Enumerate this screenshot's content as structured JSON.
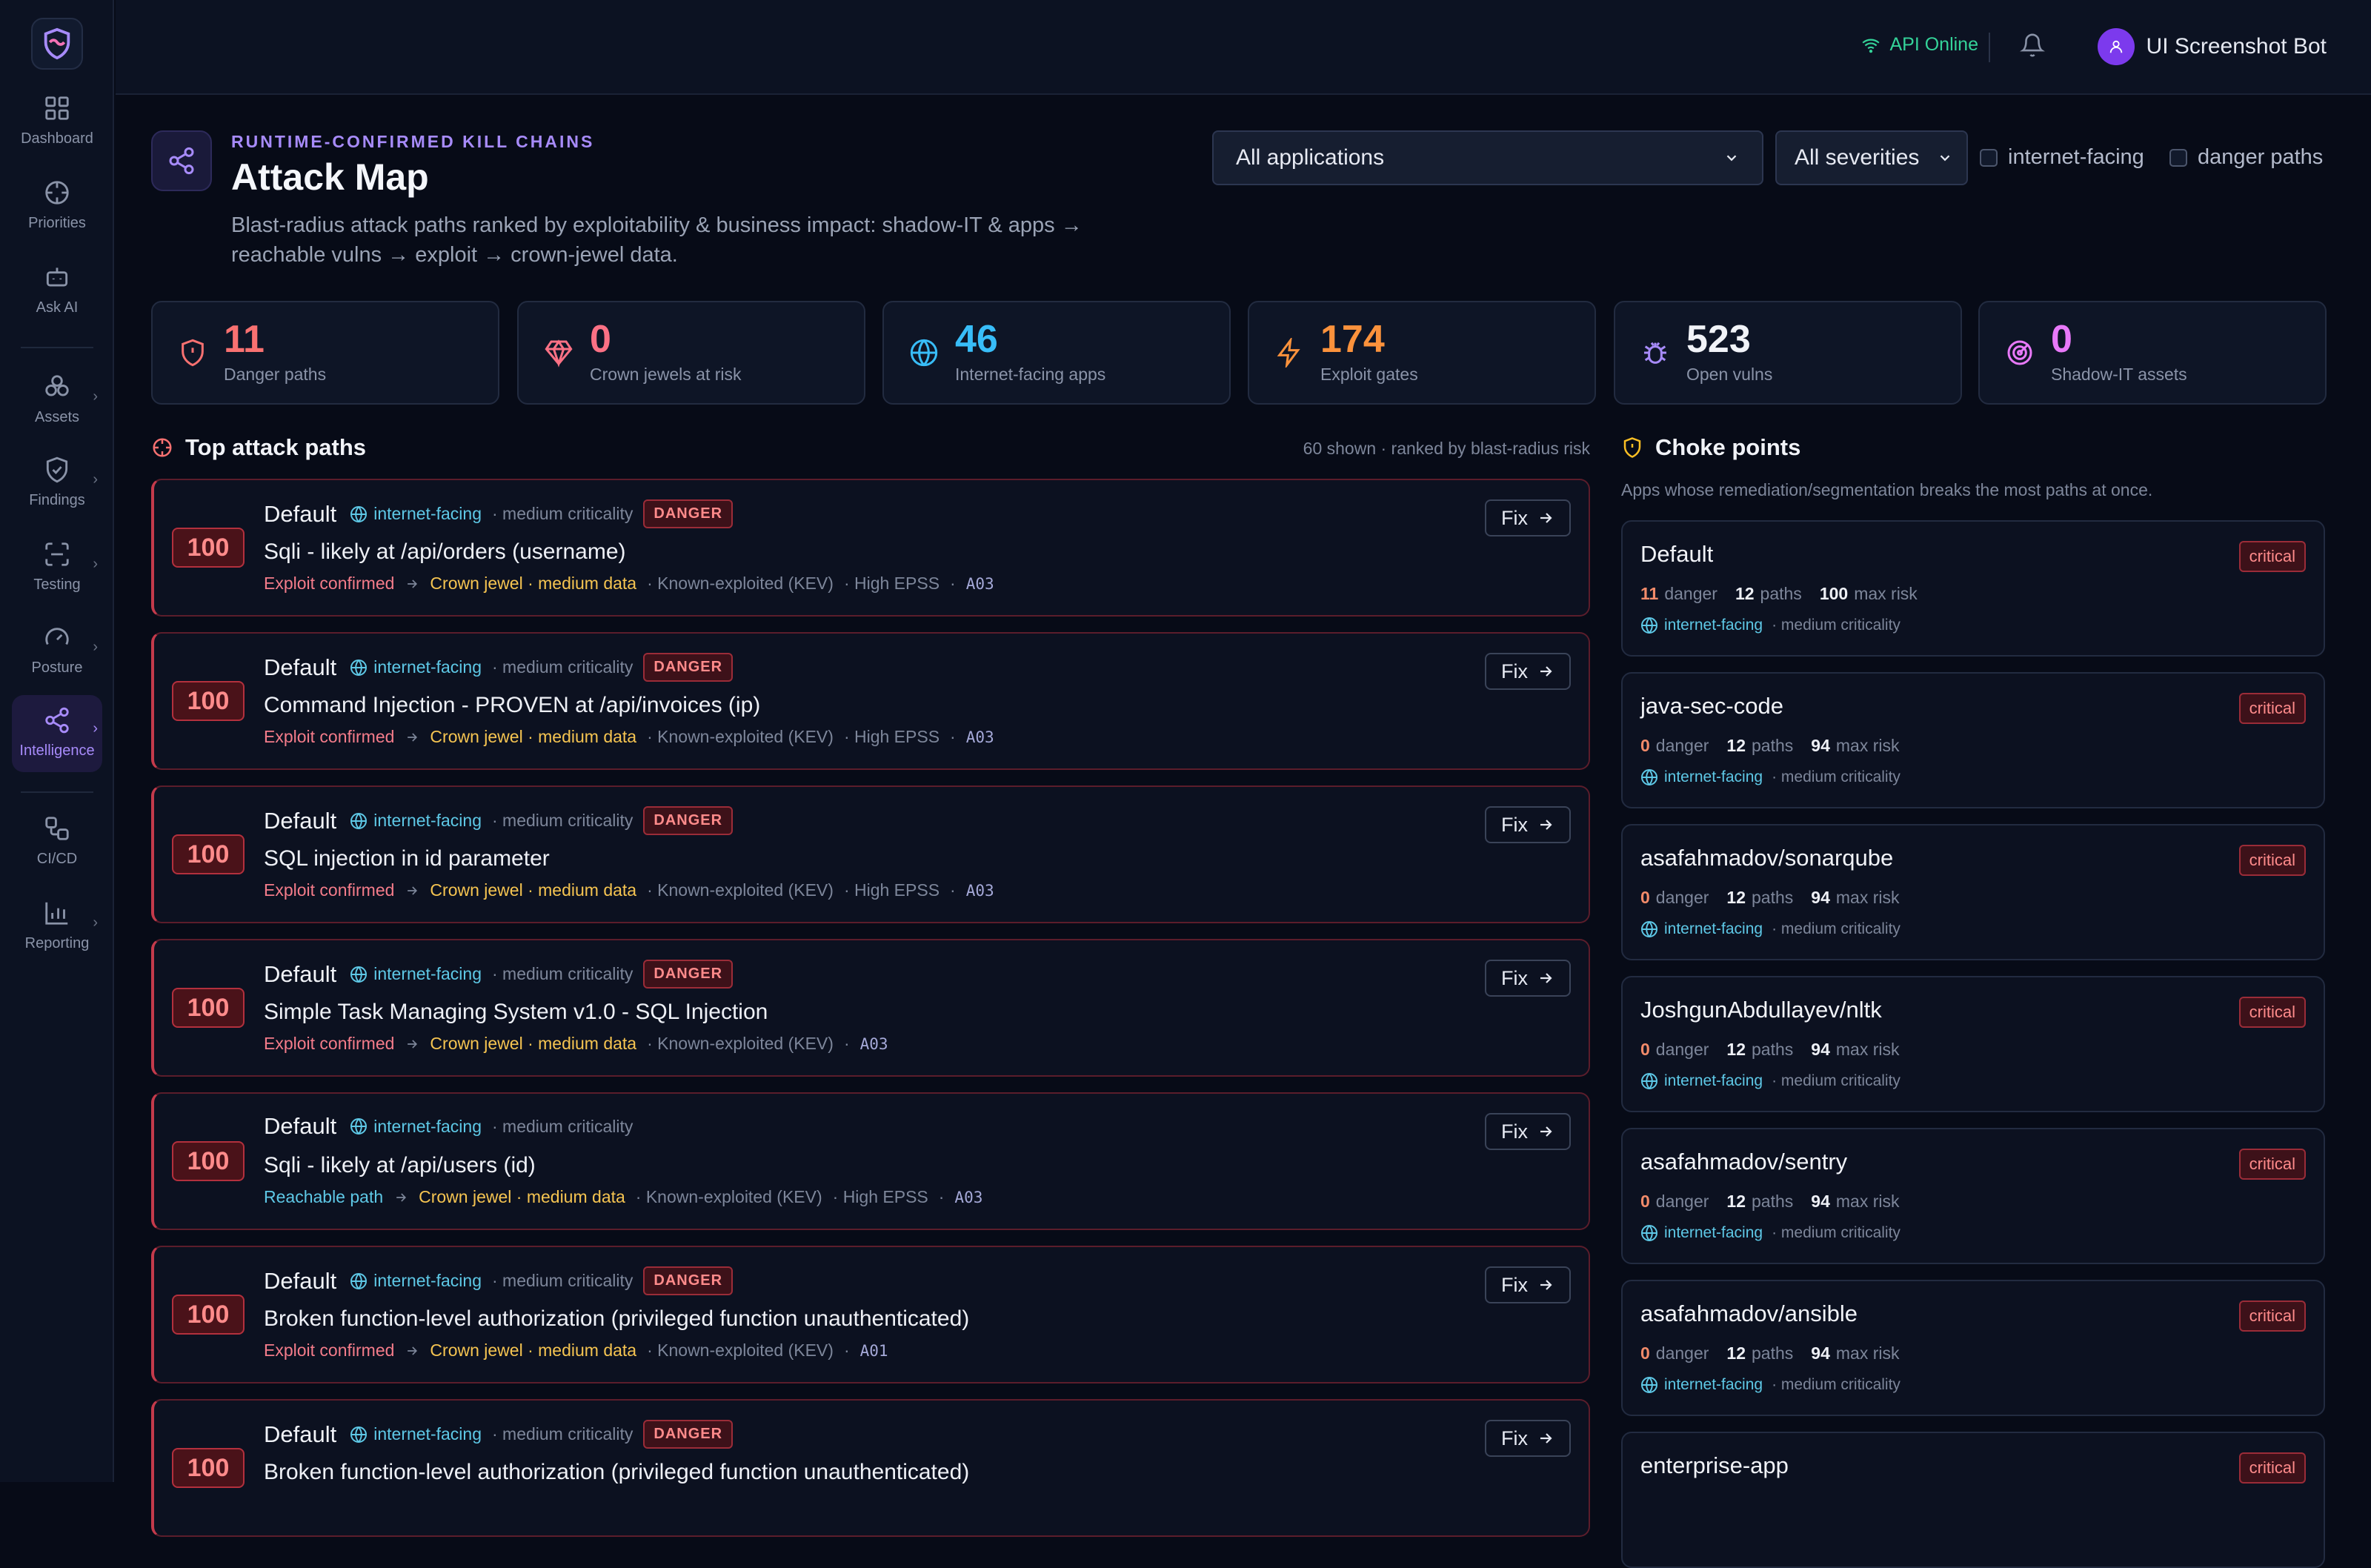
{
  "sidebar": {
    "items": [
      {
        "label": "Dashboard",
        "icon": "grid-icon"
      },
      {
        "label": "Priorities",
        "icon": "crosshair-icon"
      },
      {
        "label": "Ask AI",
        "icon": "bot-icon"
      },
      {
        "label": "Assets",
        "icon": "boxes-icon"
      },
      {
        "label": "Findings",
        "icon": "shield-check-icon"
      },
      {
        "label": "Testing",
        "icon": "scan-icon"
      },
      {
        "label": "Posture",
        "icon": "gauge-icon"
      },
      {
        "label": "Intelligence",
        "icon": "share-icon",
        "active": true
      },
      {
        "label": "CI/CD",
        "icon": "workflow-icon"
      },
      {
        "label": "Reporting",
        "icon": "bar-chart-icon"
      }
    ]
  },
  "header": {
    "api_status": "API Online",
    "user_name": "UI Screenshot Bot"
  },
  "page": {
    "eyebrow": "RUNTIME-CONFIRMED KILL CHAINS",
    "title": "Attack Map",
    "description": "Blast-radius attack paths ranked by exploitability & business impact: shadow-IT & apps → reachable vulns → exploit → crown-jewel data."
  },
  "filters": {
    "application": "All applications",
    "severity": "All severities",
    "internet_facing": "internet-facing",
    "danger_paths": "danger paths"
  },
  "stats": [
    {
      "value": "11",
      "label": "Danger paths",
      "color": "#f87171"
    },
    {
      "value": "0",
      "label": "Crown jewels at risk",
      "color": "#fb7185"
    },
    {
      "value": "46",
      "label": "Internet-facing apps",
      "color": "#38bdf8"
    },
    {
      "value": "174",
      "label": "Exploit gates",
      "color": "#fb923c"
    },
    {
      "value": "523",
      "label": "Open vulns",
      "color": "#f1f3f8"
    },
    {
      "value": "0",
      "label": "Shadow-IT assets",
      "color": "#e879f9"
    }
  ],
  "attack_paths": {
    "title": "Top attack paths",
    "meta": "60 shown · ranked by blast-radius risk",
    "fix_label": "Fix",
    "items": [
      {
        "score": "100",
        "app": "Default",
        "net": "internet-facing",
        "crit": "· medium criticality",
        "badge": "DANGER",
        "title": "Sqli - likely at /api/orders (username)",
        "evidence": "Exploit confirmed",
        "crown": "Crown jewel · medium data",
        "kev": "· Known-exploited (KEV)",
        "epss": "· High EPSS",
        "owasp": "A03"
      },
      {
        "score": "100",
        "app": "Default",
        "net": "internet-facing",
        "crit": "· medium criticality",
        "badge": "DANGER",
        "title": "Command Injection - PROVEN at /api/invoices (ip)",
        "evidence": "Exploit confirmed",
        "crown": "Crown jewel · medium data",
        "kev": "· Known-exploited (KEV)",
        "epss": "· High EPSS",
        "owasp": "A03"
      },
      {
        "score": "100",
        "app": "Default",
        "net": "internet-facing",
        "crit": "· medium criticality",
        "badge": "DANGER",
        "title": "SQL injection in id parameter",
        "evidence": "Exploit confirmed",
        "crown": "Crown jewel · medium data",
        "kev": "· Known-exploited (KEV)",
        "epss": "· High EPSS",
        "owasp": "A03"
      },
      {
        "score": "100",
        "app": "Default",
        "net": "internet-facing",
        "crit": "· medium criticality",
        "badge": "DANGER",
        "title": "Simple Task Managing System v1.0 - SQL Injection",
        "evidence": "Exploit confirmed",
        "crown": "Crown jewel · medium data",
        "kev": "· Known-exploited (KEV)",
        "epss": "",
        "owasp": "A03"
      },
      {
        "score": "100",
        "app": "Default",
        "net": "internet-facing",
        "crit": "· medium criticality",
        "badge": "",
        "title": "Sqli - likely at /api/users (id)",
        "evidence": "Reachable path",
        "crown": "Crown jewel · medium data",
        "kev": "· Known-exploited (KEV)",
        "epss": "· High EPSS",
        "owasp": "A03"
      },
      {
        "score": "100",
        "app": "Default",
        "net": "internet-facing",
        "crit": "· medium criticality",
        "badge": "DANGER",
        "title": "Broken function-level authorization (privileged function unauthenticated)",
        "evidence": "Exploit confirmed",
        "crown": "Crown jewel · medium data",
        "kev": "· Known-exploited (KEV)",
        "epss": "",
        "owasp": "A01"
      },
      {
        "score": "100",
        "app": "Default",
        "net": "internet-facing",
        "crit": "· medium criticality",
        "badge": "DANGER",
        "title": "Broken function-level authorization (privileged function unauthenticated)",
        "evidence": "",
        "crown": "",
        "kev": "",
        "epss": "",
        "owasp": ""
      }
    ]
  },
  "choke_points": {
    "title": "Choke points",
    "subtitle": "Apps whose remediation/segmentation breaks the most paths at once.",
    "labels": {
      "danger": "danger",
      "paths": "paths",
      "max_risk": "max risk"
    },
    "items": [
      {
        "name": "Default",
        "badge": "critical",
        "danger": "11",
        "paths": "12",
        "max_risk": "100",
        "net": "internet-facing",
        "crit": "· medium criticality"
      },
      {
        "name": "java-sec-code",
        "badge": "critical",
        "danger": "0",
        "paths": "12",
        "max_risk": "94",
        "net": "internet-facing",
        "crit": "· medium criticality"
      },
      {
        "name": "asafahmadov/sonarqube",
        "badge": "critical",
        "danger": "0",
        "paths": "12",
        "max_risk": "94",
        "net": "internet-facing",
        "crit": "· medium criticality"
      },
      {
        "name": "JoshgunAbdullayev/nltk",
        "badge": "critical",
        "danger": "0",
        "paths": "12",
        "max_risk": "94",
        "net": "internet-facing",
        "crit": "· medium criticality"
      },
      {
        "name": "asafahmadov/sentry",
        "badge": "critical",
        "danger": "0",
        "paths": "12",
        "max_risk": "94",
        "net": "internet-facing",
        "crit": "· medium criticality"
      },
      {
        "name": "asafahmadov/ansible",
        "badge": "critical",
        "danger": "0",
        "paths": "12",
        "max_risk": "94",
        "net": "internet-facing",
        "crit": "· medium criticality"
      },
      {
        "name": "enterprise-app",
        "badge": "critical",
        "danger": "",
        "paths": "",
        "max_risk": "",
        "net": "",
        "crit": ""
      }
    ]
  }
}
